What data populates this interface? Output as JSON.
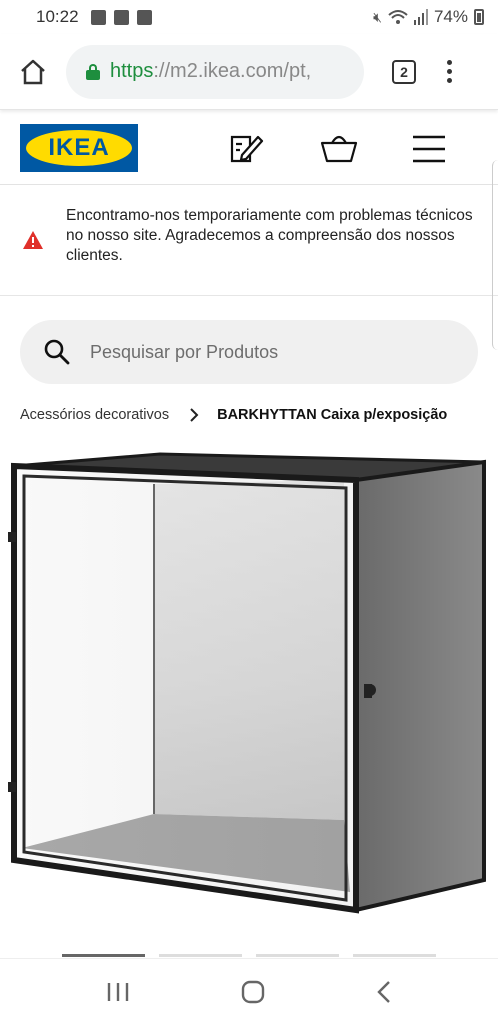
{
  "status_bar": {
    "time": "10:22",
    "battery": "74%",
    "left_icons": [
      "image-icon",
      "facebook-icon",
      "checkbox-icon"
    ],
    "right_icons": [
      "mute-icon",
      "wifi-icon",
      "signal-icon",
      "battery-icon"
    ]
  },
  "browser": {
    "url_scheme": "https",
    "url_rest": "://m2.ikea.com/pt,",
    "tab_count": "2"
  },
  "site": {
    "logo_text": "IKEA",
    "icons": [
      "shopping-list-icon",
      "basket-icon",
      "hamburger-menu-icon"
    ]
  },
  "notice": {
    "text": "Encontramo-nos temporariamente com problemas técnicos no nosso site. Agradecemos a compreensão dos nossos clientes."
  },
  "search": {
    "placeholder": "Pesquisar por Produtos"
  },
  "breadcrumb": {
    "parent": "Acessórios decorativos",
    "current": "BARKHYTTAN Caixa p/exposição"
  },
  "carousel": {
    "count": 4,
    "active_index": 0
  },
  "colors": {
    "ikea_blue": "#0058a3",
    "ikea_yellow": "#ffdb00",
    "warning_red": "#e0302a",
    "secure_green": "#1e8e3e"
  }
}
